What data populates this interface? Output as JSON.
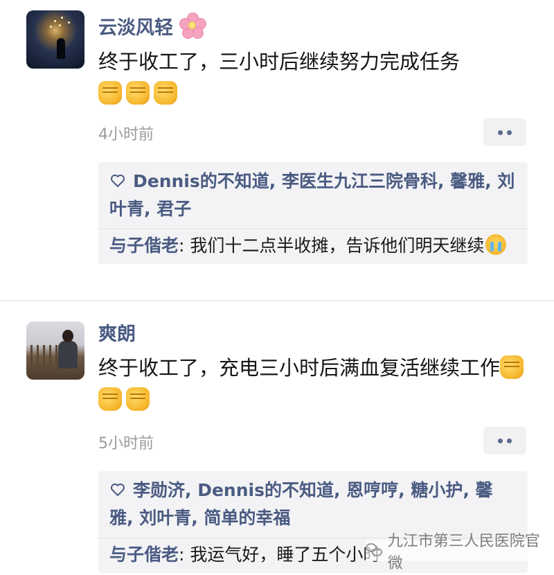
{
  "posts": [
    {
      "author": "云淡风轻",
      "text": "终于收工了，三小时后继续努力完成任务",
      "emoji_count": 3,
      "time": "4小时前",
      "likes": "Dennis的不知道, 李医生九江三院骨科, 馨雅, 刘叶青, 君子",
      "comment_author": "与子偕老",
      "comment_text": ": 我们十二点半收摊，告诉他们明天继续"
    },
    {
      "author": "爽朗",
      "text": "终于收工了，充电三小时后满血复活继续工作",
      "emoji_count": 3,
      "time": "5小时前",
      "likes": "李勋济, Dennis的不知道, 恩哼哼, 糖小护, 馨雅, 刘叶青, 简单的幸福",
      "comment_author": "与子偕老",
      "comment_text": ": 我运气好，睡了五个小时"
    }
  ],
  "watermark": "九江市第三人民医院官微",
  "colors": {
    "name": "#4a5b82",
    "time": "#9a9a9a",
    "panel": "#f3f3f5"
  },
  "icons": [
    "flower-icon",
    "fist-icon",
    "heart-icon",
    "more-dots-icon",
    "crying-face-icon",
    "wechat-icon"
  ]
}
